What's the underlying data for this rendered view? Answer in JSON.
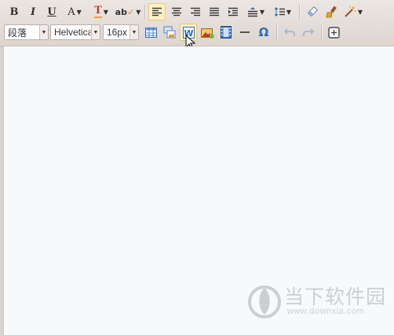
{
  "toolbar": {
    "bold": "B",
    "italic": "I",
    "underline": "U",
    "font_color": "A",
    "back_color": "T",
    "spellcheck": "ab",
    "paragraph": "段落",
    "font_family": "Helvetica",
    "font_size": "16px",
    "special_char": "Ω"
  },
  "watermark": {
    "title": "当下软件园",
    "url": "www.downxia.com"
  },
  "colors": {
    "active_bg": "#fbf1c8",
    "active_border": "#e8c96a",
    "editor_bg": "#f8f9fb",
    "icon_blue": "#2a6ebb"
  },
  "state": {
    "align_left_active": true,
    "word_paste_hovered": true,
    "undo_enabled": false,
    "redo_enabled": false
  }
}
